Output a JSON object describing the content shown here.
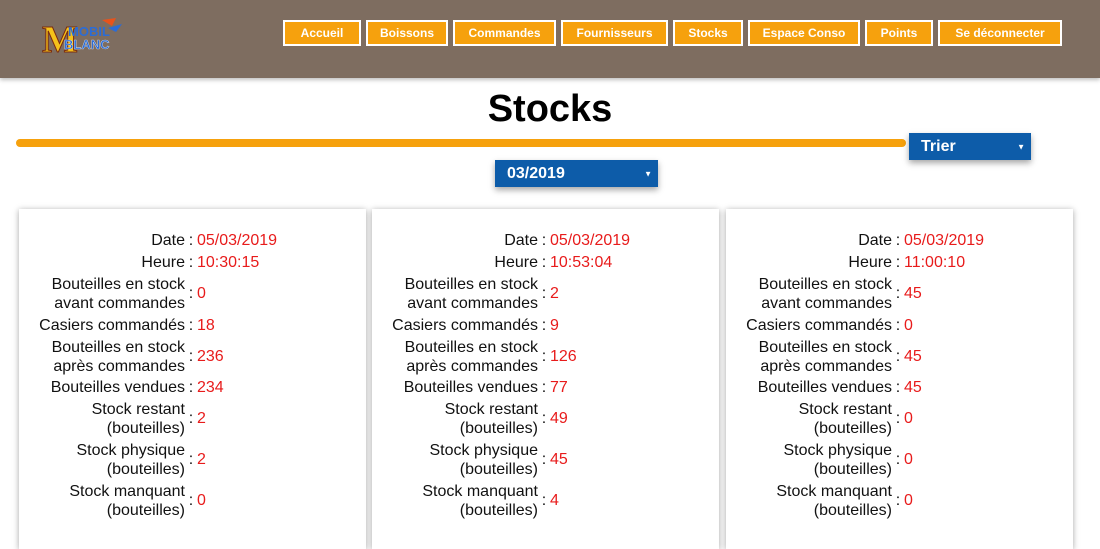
{
  "header": {
    "logo": {
      "text_top": "MOBIL",
      "text_bottom": "BLANC"
    },
    "nav": [
      {
        "label": "Accueil"
      },
      {
        "label": "Boissons"
      },
      {
        "label": "Commandes"
      },
      {
        "label": "Fournisseurs"
      },
      {
        "label": "Stocks"
      },
      {
        "label": "Espace Conso"
      },
      {
        "label": "Points"
      },
      {
        "label": "Se déconnecter"
      }
    ]
  },
  "page": {
    "title": "Stocks",
    "sort_select": "Trier",
    "period_select": "03/2019"
  },
  "colors": {
    "header_bg": "#7e6d60",
    "accent_orange": "#f6a10d",
    "select_blue": "#0d5ca9",
    "value_red": "#e81b1b"
  },
  "labels": {
    "date": "Date",
    "heure": "Heure",
    "bouteilles_avant": "Bouteilles en stock avant commandes",
    "casiers": "Casiers commandés",
    "bouteilles_apres": "Bouteilles en stock après commandes",
    "vendues": "Bouteilles vendues",
    "restant": "Stock restant (bouteilles)",
    "physique": "Stock physique (bouteilles)",
    "manquant": "Stock manquant (bouteilles)",
    "separator": ":"
  },
  "cards": [
    {
      "date": "05/03/2019",
      "heure": "10:30:15",
      "bouteilles_avant": "0",
      "casiers": "18",
      "bouteilles_apres": "236",
      "vendues": "234",
      "restant": "2",
      "physique": "2",
      "manquant": "0"
    },
    {
      "date": "05/03/2019",
      "heure": "10:53:04",
      "bouteilles_avant": "2",
      "casiers": "9",
      "bouteilles_apres": "126",
      "vendues": "77",
      "restant": "49",
      "physique": "45",
      "manquant": "4"
    },
    {
      "date": "05/03/2019",
      "heure": "11:00:10",
      "bouteilles_avant": "45",
      "casiers": "0",
      "bouteilles_apres": "45",
      "vendues": "45",
      "restant": "0",
      "physique": "0",
      "manquant": "0"
    }
  ]
}
